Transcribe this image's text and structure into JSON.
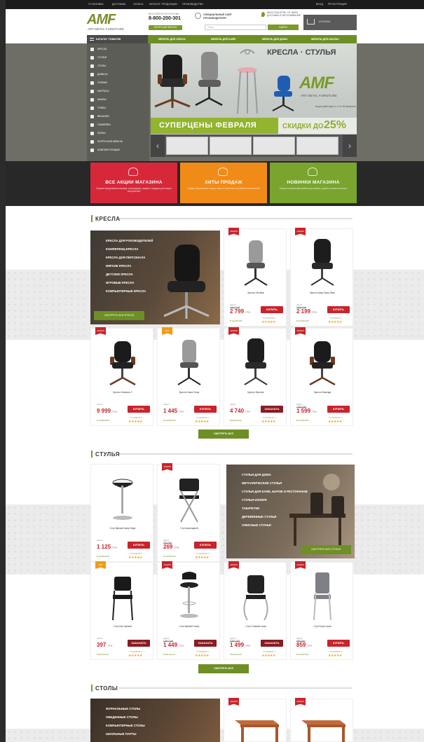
{
  "topbar": {
    "links": [
      "УСТАНОВКА",
      "ДОСТАВКА",
      "ОПЛАТА",
      "КАТАЛОГ ПРОДУКЦИИ",
      "ПРОИЗВОДСТВО"
    ],
    "login": "ВХОД",
    "register": "РЕГИСТРАЦИЯ"
  },
  "header": {
    "logo_mark": "AMF",
    "logo_sub": "ART METAL FURNITURE",
    "phone_note": "БЕСПЛАТНО ПО РОССИИ",
    "phone": "8-800-200-301",
    "callback": "ОБРАТНЫЙ ЗВОНОК",
    "official_line1": "ОФИЦИАЛЬНЫЙ САЙТ",
    "official_line2": "ПРОИЗВОДИТЕЛЯ",
    "address": "МЫ В СОЦСЕТЯХ: УЛ. МИРА, ДОСТАВКА И ОБСЛУЖИВАНИЕ",
    "search_placeholder": "Поиск",
    "search_button": "НАЙТИ",
    "cart": "КОРЗИНА"
  },
  "nav": {
    "catalog": "КАТАЛОГ ТОВАРОВ",
    "items": [
      "МЕБЕЛЬ ДЛЯ ОФИСА",
      "МЕБЕЛЬ ДЛЯ КАФЕ",
      "МЕБЕЛЬ ДЛЯ ДОМА",
      "МЕБЕЛЬ ДЛЯ ШКОЛЫ"
    ]
  },
  "sidebar": [
    "КРЕСЛА",
    "СТУЛЬЯ",
    "СТОЛЫ",
    "ДИВАНЫ",
    "ПУФИКИ",
    "МАТРАСЫ",
    "ШКАФЫ",
    "ТУМБЫ",
    "ВЕШАЛКИ",
    "СКАМЕЙКИ",
    "ПОЛКИ",
    "КОРПУСНАЯ МЕБЕЛЬ",
    "КОМПЛЕКТУЮЩИЕ"
  ],
  "banner": {
    "title": "КРЕСЛА · СТУЛЬЯ",
    "mark": "AMF",
    "mark_sub": "ART METAL FURNITURE",
    "note": "Акция действует с 1 по 28 февраля",
    "left": "СУПЕРЦЕНЫ ФЕВРАЛЯ",
    "right_label": "СКИДКИ ДО",
    "right_value": "25%"
  },
  "promos": [
    {
      "title": "ВСЕ АКЦИИ МАГАЗИНА",
      "sub": "Лучшие предложения месяца: распродажа, скидки и подарки для наших покупателей",
      "color": "#d7283a"
    },
    {
      "title": "ХИТЫ ПРОДАЖ",
      "sub": "Самые популярные товары нашего магазина по мнению покупателей",
      "color": "#f18b17"
    },
    {
      "title": "НОВИНКИ МАГАЗИНА",
      "sub": "Новые поступления мебели для офиса и дома в нашем каталоге",
      "color": "#79a52e"
    }
  ],
  "sections": {
    "chairs": "КРЕСЛА",
    "stools": "СТУЛЬЯ",
    "tables": "СТОЛЫ"
  },
  "chairs_feature": {
    "items": [
      "КРЕСЛА ДЛЯ РУКОВОДИТЕЛЕЙ",
      "КОНФЕРЕНЦ-КРЕСЛА",
      "КРЕСЛА ДЛЯ ПЕРСОНАЛА",
      "МЯГКИЕ КРЕСЛА",
      "ДЕТСКИЕ КРЕСЛА",
      "ИГРОВЫЕ КРЕСЛА",
      "КОМПЬЮТЕРНЫЕ КРЕСЛА"
    ],
    "button": "СМОТРЕТЬ ВСЕ КРЕСЛА"
  },
  "chairs": [
    {
      "badge": "АКЦИЯ",
      "name": "Кресло Оптима",
      "old": "3060 ГРН",
      "price": "2 799",
      "button": "КУПИТЬ",
      "avail": "В НАЛИЧИИ",
      "badge_hit": false
    },
    {
      "badge": "АКЦИЯ",
      "name": "Кресло Шеф Хром Люкс",
      "old": "2845 ГРН",
      "price": "2 199",
      "button": "КУПИТЬ",
      "avail": "В НАЛИЧИИ",
      "badge_hit": false
    },
    {
      "badge": "АКЦИЯ",
      "name": "Кресло Неаполь Z",
      "old": "",
      "price": "9 999",
      "button": "КУПИТЬ",
      "avail": "В НАЛИЧИИ",
      "badge_hit": false
    },
    {
      "badge": "ХИТ",
      "name": "Кресло Ника Сетка",
      "old": "",
      "price": "1 445",
      "button": "КУПИТЬ",
      "avail": "В НАЛИЧИИ",
      "badge_hit": true
    },
    {
      "badge": "АКЦИЯ",
      "name": "Кресло Мустанг",
      "old": "",
      "price": "4 740",
      "button": "ЗАКАЗАТЬ",
      "avail": "ПОД ЗАКАЗ",
      "badge_hit": false
    },
    {
      "badge": "АКЦИЯ",
      "name": "Кресло Фазенда",
      "old": "1789 ГРН",
      "price": "1 599",
      "button": "КУПИТЬ",
      "avail": "В НАЛИЧИИ",
      "badge_hit": false
    }
  ],
  "chairs_more": "СМОТРЕТЬ ВСЕ",
  "stools_feature": {
    "items": [
      "СТУЛЬЯ ДЛЯ ДОМА",
      "МЕТАЛЛИЧЕСКИЕ СТУЛЬЯ",
      "СТУЛЬЯ ДЛЯ КАФЕ, БАРОВ И РЕСТОРАНОВ",
      "СТУЛЬЯ ИЗОКРЕ",
      "ТАБУРЕТКИ",
      "ДЕРЕВЯННЫЕ СТУЛЬЯ",
      "ОФИСНЫЕ СТУЛЬЯ"
    ],
    "button": "СМОТРЕТЬ ВСЕ СТУЛЬЯ"
  },
  "stools": [
    {
      "badge": "",
      "name": "Стул барный хокер Бари",
      "old": "",
      "price": "1 125",
      "button": "КУПИТЬ",
      "avail": "В НАЛИЧИИ",
      "badge_hit": false
    },
    {
      "badge": "АКЦИЯ",
      "name": "Стул раскладной",
      "old": "295 ГРН",
      "price": "269",
      "button": "КУПИТЬ",
      "avail": "В НАЛИЧИИ",
      "badge_hit": false
    },
    {
      "badge": "ХИТ",
      "name": "Стул Изо черный",
      "old": "",
      "price": "397",
      "button": "ЗАКАЗАТЬ",
      "avail": "ПОД ЗАКАЗ",
      "badge_hit": true
    },
    {
      "badge": "АКЦИЯ",
      "name": "Стул барный Хокер",
      "old": "1560 ГРН",
      "price": "1 449",
      "button": "ЗАКАЗАТЬ",
      "avail": "ПОД ЗАКАЗ",
      "badge_hit": false
    },
    {
      "badge": "АКЦИЯ",
      "name": "Стул Сильвия хром",
      "old": "1999 ГРН",
      "price": "1 499",
      "button": "ЗАКАЗАТЬ",
      "avail": "ПОД ЗАКАЗ",
      "badge_hit": false
    },
    {
      "badge": "АКЦИЯ",
      "name": "Стул Боунс хром",
      "old": "999 ГРН",
      "price": "859",
      "button": "КУПИТЬ",
      "avail": "В НАЛИЧИИ",
      "badge_hit": false
    }
  ],
  "stools_more": "СМОТРЕТЬ ВСЕ",
  "tables_feature": {
    "items": [
      "ЖУРНАЛЬНЫЕ СТОЛЫ",
      "ОБЕДЕННЫЕ СТОЛЫ",
      "КОМПЬЮТЕРНЫЕ СТОЛЫ",
      "ШКОЛЬНЫЕ ПАРТЫ"
    ]
  },
  "tables": [
    {
      "badge": "АКЦИЯ"
    },
    {
      "badge": "АКЦИЯ"
    }
  ],
  "common": {
    "price_label": "ЦЕНА",
    "currency": "ГРН",
    "reviews": "ОТЗЫВОВ: 0",
    "stars": "★★★★★"
  }
}
